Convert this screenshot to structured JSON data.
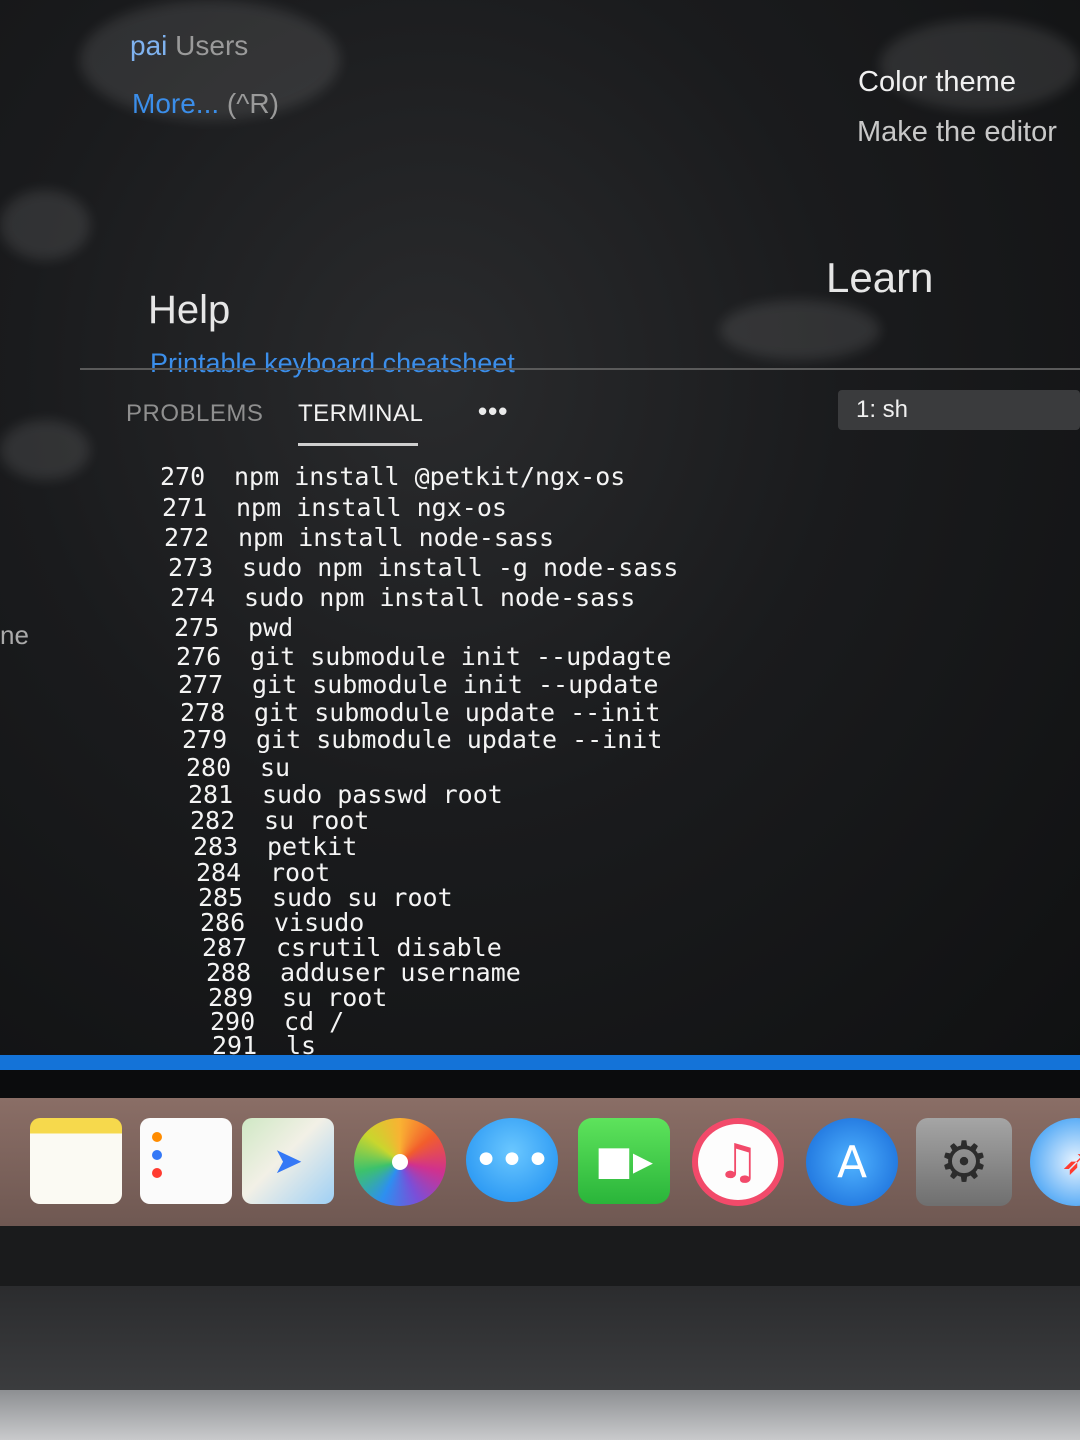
{
  "welcome": {
    "recent_item_label": "pai",
    "recent_item_path": "Users",
    "recent_more_label": "More...",
    "recent_more_shortcut": "(^R)",
    "side_fragment": "ne",
    "help_heading": "Help",
    "help_link": "Printable keyboard cheatsheet",
    "learn_heading": "Learn",
    "color_theme_title": "Color theme",
    "color_theme_desc": "Make the editor"
  },
  "panel": {
    "tabs": [
      {
        "label": "PROBLEMS",
        "active": false
      },
      {
        "label": "TERMINAL",
        "active": true
      }
    ],
    "more_label": "•••",
    "terminal_selector": "1: sh"
  },
  "terminal": {
    "lines": [
      {
        "num": "270",
        "cmd": "npm install @petkit/ngx-os"
      },
      {
        "num": "271",
        "cmd": "npm install ngx-os"
      },
      {
        "num": "272",
        "cmd": "npm install node-sass"
      },
      {
        "num": "273",
        "cmd": "sudo npm install -g node-sass"
      },
      {
        "num": "274",
        "cmd": "sudo npm install node-sass"
      },
      {
        "num": "275",
        "cmd": "pwd"
      },
      {
        "num": "276",
        "cmd": "git submodule init --updagte"
      },
      {
        "num": "277",
        "cmd": "git submodule init --update"
      },
      {
        "num": "278",
        "cmd": "git submodule update --init"
      },
      {
        "num": "279",
        "cmd": "git submodule update --init"
      },
      {
        "num": "280",
        "cmd": "su"
      },
      {
        "num": "281",
        "cmd": "sudo passwd root"
      },
      {
        "num": "282",
        "cmd": "su root"
      },
      {
        "num": "283",
        "cmd": "petkit"
      },
      {
        "num": "284",
        "cmd": "root"
      },
      {
        "num": "285",
        "cmd": "sudo su root"
      },
      {
        "num": "286",
        "cmd": "visudo"
      },
      {
        "num": "287",
        "cmd": "csrutil disable"
      },
      {
        "num": "288",
        "cmd": "adduser username"
      },
      {
        "num": "289",
        "cmd": "su root"
      },
      {
        "num": "290",
        "cmd": "cd /"
      },
      {
        "num": "291",
        "cmd": "ls"
      }
    ]
  },
  "dock": {
    "icons": [
      "notes-icon",
      "reminders-icon",
      "maps-icon",
      "photos-icon",
      "messages-icon",
      "facetime-icon",
      "music-icon",
      "app-store-icon",
      "system-preferences-icon",
      "safari-icon"
    ]
  },
  "colors": {
    "status_bar": "#1473d8",
    "link": "#3b8eea",
    "terminal_text": "#f4f4f4"
  }
}
